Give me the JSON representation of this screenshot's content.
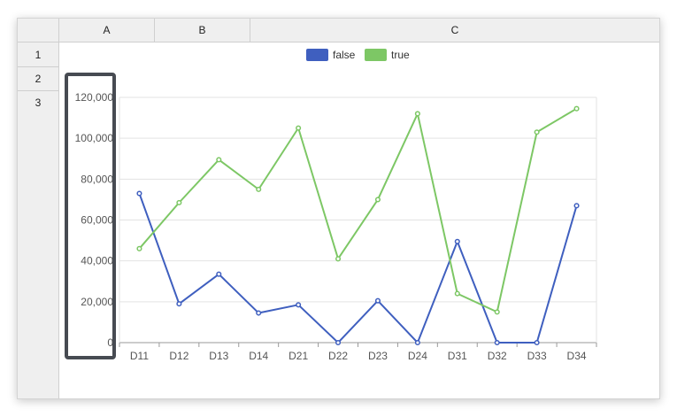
{
  "sheet": {
    "columns": [
      {
        "label": "A"
      },
      {
        "label": "B"
      },
      {
        "label": "C"
      }
    ],
    "rows": [
      {
        "label": "1"
      },
      {
        "label": "2"
      },
      {
        "label": "3"
      }
    ]
  },
  "colors": {
    "false": "#3f5fbf",
    "true": "#7dc765",
    "selection": "#474b52"
  },
  "chart_data": {
    "type": "line",
    "categories": [
      "D11",
      "D12",
      "D13",
      "D14",
      "D21",
      "D22",
      "D23",
      "D24",
      "D31",
      "D32",
      "D33",
      "D34"
    ],
    "series": [
      {
        "name": "false",
        "values": [
          73000,
          19000,
          33500,
          14500,
          18500,
          0,
          20500,
          0,
          49500,
          0,
          0,
          67000
        ]
      },
      {
        "name": "true",
        "values": [
          46000,
          68500,
          89500,
          75000,
          105000,
          41000,
          70000,
          112000,
          24000,
          15000,
          103000,
          114500
        ]
      }
    ],
    "yticks": [
      "0",
      "20,000",
      "40,000",
      "60,000",
      "80,000",
      "100,000",
      "120,000"
    ],
    "ylim": [
      0,
      120000
    ],
    "legend_position": "top-center",
    "grid": true
  }
}
